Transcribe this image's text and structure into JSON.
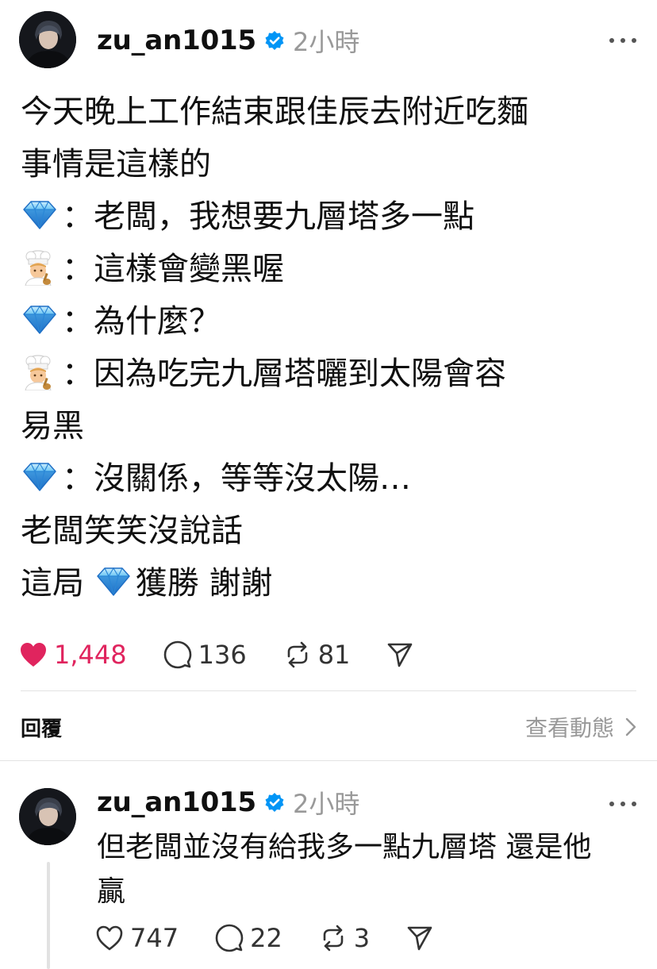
{
  "post": {
    "username": "zu_an1015",
    "time": "2小時",
    "lines": [
      {
        "emoji": "",
        "text": "今天晚上工作結束跟佳辰去附近吃麵"
      },
      {
        "emoji": "",
        "text": "事情是這樣的"
      },
      {
        "emoji": "gem",
        "text": "：老闆，我想要九層塔多一點"
      },
      {
        "emoji": "chef",
        "text": "：這樣會變黑喔"
      },
      {
        "emoji": "gem",
        "text": "：為什麼？"
      },
      {
        "emoji": "chef",
        "text": "：因為吃完九層塔曬到太陽會容"
      },
      {
        "emoji": "",
        "text": "易黑"
      },
      {
        "emoji": "gem",
        "text": "：沒關係，等等沒太陽…"
      },
      {
        "emoji": "",
        "text": "老闆笑笑沒說話"
      },
      {
        "emoji": "",
        "text_before": "這局 ",
        "emoji_inline": "gem",
        "text": "獲勝 謝謝"
      }
    ],
    "likes": "1,448",
    "comments": "136",
    "reposts": "81",
    "liked": true,
    "like_color": "#e0245e"
  },
  "replies_section": {
    "title": "回覆",
    "view_activity": "查看動態"
  },
  "reply": {
    "username": "zu_an1015",
    "time": "2小時",
    "lines": [
      "但老闆並沒有給我多一點九層塔 還是他",
      "贏"
    ],
    "likes": "747",
    "comments": "22",
    "reposts": "3"
  },
  "icons": {
    "verified": "verified-badge-icon",
    "like": "heart-icon",
    "comment": "comment-bubble-icon",
    "repost": "repost-icon",
    "share": "send-icon",
    "more": "more-dots-icon",
    "chevron": "chevron-right-icon"
  },
  "colors": {
    "verified": "#0095f6",
    "muted": "#999999",
    "text": "#101010"
  }
}
